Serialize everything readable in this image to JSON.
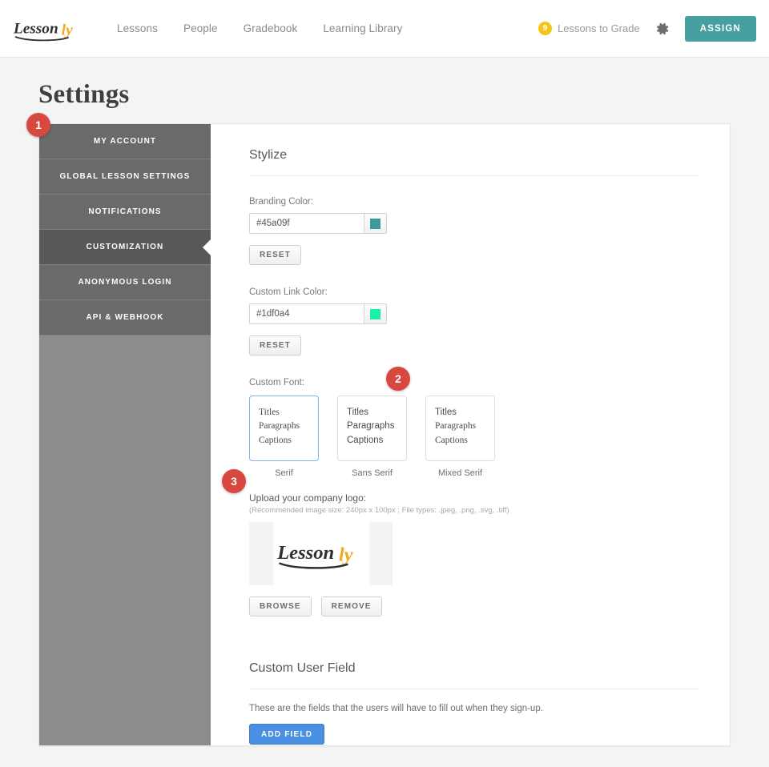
{
  "topbar": {
    "logo_text_dark": "Lesson",
    "logo_text_accent": "ly",
    "nav": [
      {
        "label": "Lessons"
      },
      {
        "label": "People"
      },
      {
        "label": "Gradebook"
      },
      {
        "label": "Learning Library"
      }
    ],
    "grade_badge_count": "9",
    "grade_link_label": "Lessons to Grade",
    "gear_icon": "gear-icon",
    "assign_label": "ASSIGN",
    "assign_color": "#45a09f"
  },
  "page": {
    "title": "Settings"
  },
  "sidebar": {
    "items": [
      {
        "label": "MY ACCOUNT",
        "active": false
      },
      {
        "label": "GLOBAL LESSON SETTINGS",
        "active": false
      },
      {
        "label": "NOTIFICATIONS",
        "active": false
      },
      {
        "label": "CUSTOMIZATION",
        "active": true
      },
      {
        "label": "ANONYMOUS LOGIN",
        "active": false
      },
      {
        "label": "API & WEBHOOK",
        "active": false
      }
    ]
  },
  "stylize": {
    "section_title": "Stylize",
    "branding": {
      "label": "Branding Color:",
      "value": "#45a09f",
      "swatch_color": "#3d9b99",
      "reset_label": "RESET"
    },
    "link": {
      "label": "Custom Link Color:",
      "value": "#1df0a4",
      "swatch_color": "#1df0a4",
      "reset_label": "RESET"
    },
    "font": {
      "label": "Custom Font:",
      "preview_lines": [
        "Titles",
        "Paragraphs",
        "Captions"
      ],
      "options": [
        {
          "caption": "Serif",
          "selected": true
        },
        {
          "caption": "Sans Serif",
          "selected": false
        },
        {
          "caption": "Mixed Serif",
          "selected": false
        }
      ]
    },
    "logo": {
      "label": "Upload your company logo:",
      "hint": "(Recommended image size: 240px x 100px ; File types: .jpeg, .png, .svg, .tiff)",
      "browse_label": "BROWSE",
      "remove_label": "REMOVE",
      "preview_text_dark": "Lesson",
      "preview_text_accent": "ly"
    }
  },
  "custom_user_field": {
    "section_title": "Custom User Field",
    "description": "These are the fields that the users will have to fill out when they sign-up.",
    "add_field_label": "ADD FIELD",
    "add_field_color": "#4a90e2"
  },
  "annotations": [
    {
      "number": "1"
    },
    {
      "number": "2"
    },
    {
      "number": "3"
    }
  ]
}
